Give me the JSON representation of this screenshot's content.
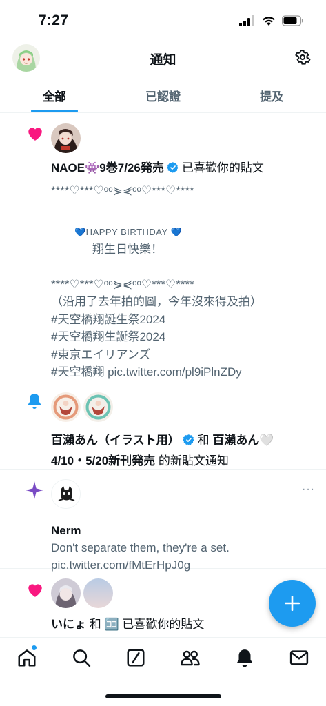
{
  "status": {
    "time": "7:27"
  },
  "header": {
    "title": "通知"
  },
  "tabs": [
    {
      "label": "全部",
      "active": true
    },
    {
      "label": "已認證",
      "active": false
    },
    {
      "label": "提及",
      "active": false
    }
  ],
  "notifications": [
    {
      "type": "like",
      "user": "NAOE👾9巻7/26発売",
      "action": "已喜歡你的貼文",
      "lines": [
        "****♡***♡ᵒᵒ⋟⋞ᵒᵒ♡***♡****",
        "",
        "💙HAPPY BIRTHDAY 💙",
        "翔生日快樂！",
        "",
        "****♡***♡ᵒᵒ⋟⋞ᵒᵒ♡***♡****",
        "（沿用了去年拍的圖，今年沒來得及拍）",
        "#天空橋翔誕生祭2024",
        "#天空橋翔生誕祭2024",
        "#東京エイリアンズ",
        "#天空橋翔 pic.twitter.com/pl9iPlnZDy"
      ]
    },
    {
      "type": "new-post",
      "user": "百瀨あん（イラスト用）",
      "and": "和",
      "user2": "百瀨あん🤍",
      "user2_cont": "4/10・5/20新刊発売",
      "suffix": "的新貼文通知"
    },
    {
      "type": "recommendation",
      "user": "Nerm",
      "text": "Don't separate them, they're a set.",
      "link": "pic.twitter.com/fMtErHpJ0g",
      "more": "···"
    },
    {
      "type": "like",
      "user": "いにょ",
      "and": "和",
      "user2": "🈁",
      "action": "已喜歡你的貼文"
    }
  ],
  "colors": {
    "accent": "#1d9bf0",
    "like": "#f91880",
    "spark": "#794bc4"
  }
}
